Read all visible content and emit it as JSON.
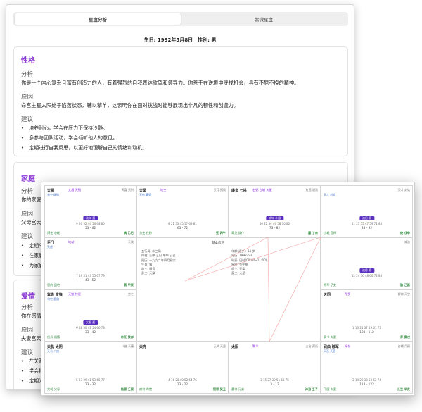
{
  "tabs": {
    "t1": "星盘分析",
    "t2": "紫微星盘"
  },
  "birth": "生日: 1992年5月8日　性别: 男",
  "card1": {
    "title": "性格",
    "a_label": "分析",
    "a_text": "你是一个内心复杂且富有创造力的人，有着强烈的自我表达欲望和领导力。你善于在逆境中寻找机会，具有不屈不挠的精神。",
    "r_label": "原因",
    "r_text": "命宫主星太阳处于陷落状态，辅以擎羊，这表明你在面对挑战时能够展现出非凡的韧性和创造力。",
    "s_label": "建议",
    "s1": "培养耐心，学会在压力下保持冷静。",
    "s2": "多参与团队活动，学会倾听他人的意见。",
    "s3": "定期进行自我反思，以更好地理解自己的情绪和动机。"
  },
  "card2": {
    "title": "家庭",
    "a_label": "分析",
    "a_text": "你的家庭关",
    "r_label": "原因",
    "r_text": "父母宫天府",
    "s_label": "建议",
    "s1": "定期与家",
    "s2": "在家庭决",
    "s3": "为家庭设"
  },
  "card3": {
    "title": "爱情",
    "a_label": "分析",
    "a_text": "你在感情上",
    "r_label": "原因",
    "r_text": "夫妻宫天机",
    "s_label": "建议",
    "s1": "在关系中",
    "s2": "学会接受",
    "s3": "定期为关"
  },
  "chart": {
    "center_title": "基本信息",
    "info_left": [
      "五行局: 水三局",
      "四柱: 壬申 乙巳 甲午 己巳",
      "阳历: 一九九二年四月初六",
      "生肖: 猴",
      "命主: 廉贞",
      "身主: 天梁"
    ],
    "info_right": [
      "年龄(虚岁): 34 岁",
      "阳历: 1992-5-8",
      "时辰: 巳时(09:00~11:00)",
      "星座: 金牛座",
      "命主: 天梁",
      "身主: 火星"
    ],
    "cells": [
      {
        "name": "天相",
        "mid": "文昌 天钺",
        "lines": "旬空 破碎",
        "right": "天喜 天刑",
        "tag": "流年 孤",
        "nums": "9 20 32 44 56 68 80",
        "age": "53 - 62",
        "bl": "博士 小耗",
        "br": "病 乙巳"
      },
      {
        "name": "天梁",
        "mid": "地空",
        "lines": "天伤 寡宿",
        "right": "天月 孤辰",
        "tag": "",
        "nums": "8 21 33 45 57 69 81",
        "age": "63 - 72",
        "bl": "力士 迁移",
        "br": "死 丙午"
      },
      {
        "name": "廉贞 七杀",
        "mid": "右弼 左辅 火星",
        "lines": "",
        "right": "红鸾 阴煞",
        "tag": "流年 小限",
        "nums": "10 22 34 46 58 70 82",
        "age": "73 - 82",
        "bl": "青龙 奴仆",
        "br": "墓 丁未"
      },
      {
        "name": "",
        "mid": "",
        "lines": "天才 封诰",
        "right": "天才 封诰",
        "tag": "流日 孤",
        "nums": "11 23 35 47 59 71 83",
        "age": "83 - 92",
        "bl": "小耗 官禄",
        "br": "绝 戊申"
      },
      {
        "name": "巨门",
        "mid": "地劫",
        "lines": "天虚",
        "right": "天姚",
        "tag": "",
        "nums": "7 19 31 43 55 67 79",
        "age": "43 - 52",
        "bl": "官府 田宅",
        "br": "衰 甲辰"
      },
      {
        "name": "",
        "mid": "",
        "lines": "",
        "right": "咸池",
        "tag": "流月 孤",
        "nums": "12 24 36 48 60 72 84",
        "age": "",
        "bl": "将军 子女",
        "br": "胎 己酉"
      },
      {
        "name": "紫微 贪狼",
        "mid": "天魁 铃星",
        "lines": "旬空 截路",
        "right": "空亡",
        "tag": "大限 孤",
        "nums": "6 18 30 42 54 66 78",
        "age": "33 - 42",
        "bl": "伏兵 福德",
        "br": "帝旺 癸卯"
      },
      {
        "name": "天同",
        "mid": "陀罗",
        "lines": "",
        "right": "解神 天空",
        "tag": "",
        "nums": "1 13 25 37 49 61 73",
        "age": "103 - 112",
        "bl": "奏书 夫妻",
        "br": "养 庚戌"
      },
      {
        "name": "天机 太阴",
        "mid": "",
        "lines": "天马 八座",
        "right": "八座 天德",
        "tag": "",
        "nums": "5 17 29 41 53 65 77",
        "age": "23 - 32",
        "bl": "大耗 父母",
        "br": "临官 壬寅"
      },
      {
        "name": "天府",
        "mid": "",
        "lines": "",
        "right": "天哭 天虚",
        "tag": "",
        "nums": "4 16 28 40 52 64 76",
        "age": "13 - 22",
        "bl": "病符 命宫",
        "br": "冠带 癸丑"
      },
      {
        "name": "太阳",
        "mid": "擎羊",
        "lines": "",
        "right": "三台 孤辰",
        "tag": "",
        "nums": "3 15 27 39 51 63 75",
        "age": "3 - 12",
        "bl": "喜神 兄弟",
        "br": "沐浴 壬子"
      },
      {
        "name": "武曲 破军",
        "mid": "禄存",
        "lines": "天巫 天德",
        "right": "台辅 月德",
        "tag": "",
        "nums": "2 14 26 38 50 62 74",
        "age": "113 - 122",
        "bl": "飞廉 夫妻",
        "br": "长生 辛亥"
      }
    ]
  }
}
